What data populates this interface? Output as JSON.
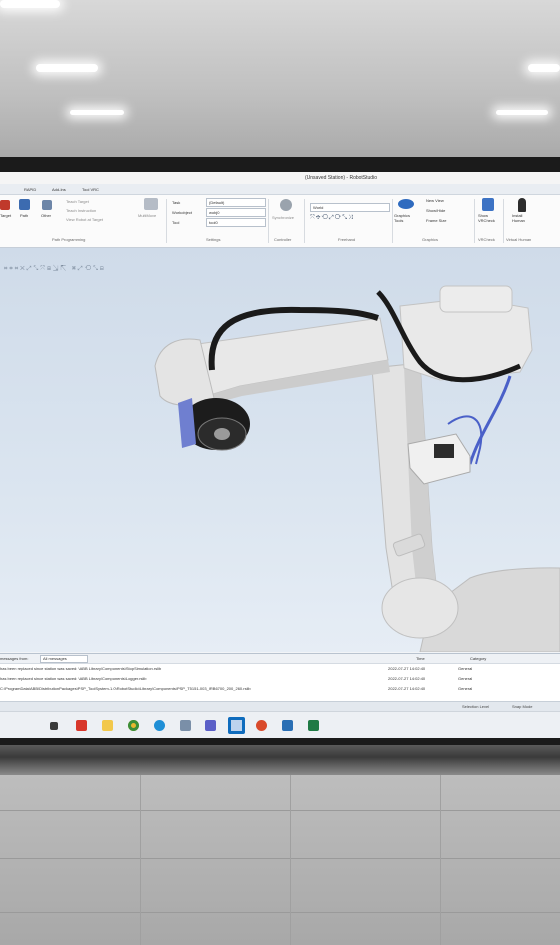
{
  "window": {
    "title": "(Unsaved Station) - RobotStudio"
  },
  "tabs": [
    "RAPID",
    "Add-Ins",
    "Tool VRC"
  ],
  "ribbon": {
    "path_programming": {
      "items": [
        "Teach Target",
        "Teach Instruction",
        "View Robot at Target"
      ],
      "icon_labels": [
        "Target",
        "Path",
        "Other"
      ],
      "multimove": "MultiMove",
      "group_label": "Path Programming"
    },
    "settings": {
      "fields": [
        {
          "label": "Task",
          "value": "(Default)"
        },
        {
          "label": "Workobject",
          "value": "wobj0"
        },
        {
          "label": "Tool",
          "value": "tool0"
        }
      ],
      "group_label": "Settings"
    },
    "controller": {
      "label": "Synchronize",
      "group_label": "Controller"
    },
    "freehand": {
      "frame_value": "World",
      "group_label": "Freehand"
    },
    "graphics": {
      "graphics_tools": "Graphics Tools",
      "items": [
        "New View",
        "Show/Hide",
        "Frame Size"
      ],
      "group_label": "Graphics"
    },
    "vrcheck": {
      "label": "Show VRCheck",
      "group_label": "VRCheck"
    },
    "virtual_human": {
      "label": "Install Human",
      "group_label": "Virtual Human"
    }
  },
  "output": {
    "messages_from_label": "messages from:",
    "filter_value": "All messages",
    "columns": [
      "Time",
      "Category"
    ],
    "rows": [
      {
        "text": "has been replaced since station was saved: \\ABB Library\\Components\\StopSimulation.rslib",
        "time": "2022-07-27 14:02:40",
        "category": "General"
      },
      {
        "text": "has been replaced since station was saved: \\ABB Library\\Components\\Logger.rslib",
        "time": "2022-07-27 14:02:40",
        "category": "General"
      },
      {
        "text": "C:\\ProgramData\\ABB\\DistributionPackages\\PSP_ToolSystem-1.0\\RobotStudio\\Library\\Components\\PSP_T5151-003_IRB6700_200_260.rslib",
        "time": "2022-07-27 14:02:40",
        "category": "General"
      }
    ]
  },
  "statusbar": {
    "selection_level": "Selection Level",
    "snap_mode": "Snap Mode"
  },
  "taskbar": {
    "icons": [
      "explorer-icon",
      "acrobat-icon",
      "files-icon",
      "chrome-icon",
      "edge-icon",
      "paint-icon",
      "teams-icon",
      "outlook-icon",
      "office-icon",
      "robotstudio-icon",
      "excel-icon"
    ]
  },
  "colors": {
    "accent": "#2b579a",
    "viewport_top": "#cfdbe9",
    "robot": "#e2e2e2"
  }
}
